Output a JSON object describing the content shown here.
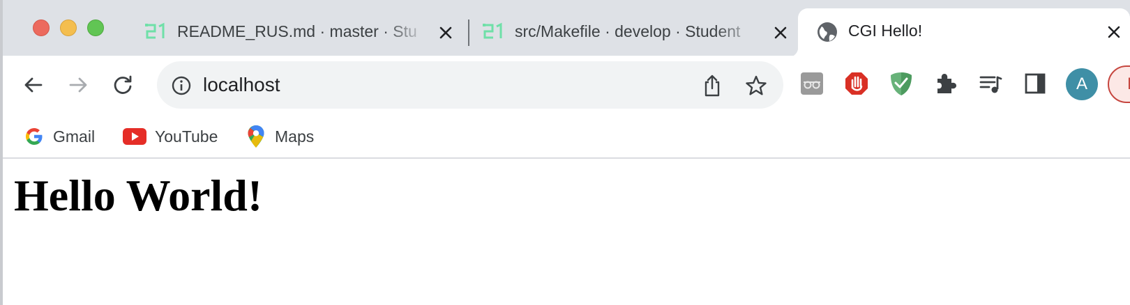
{
  "tabs": [
    {
      "title": "README_RUS.md · master · Stu",
      "favicon": "school-21-logo-icon",
      "active": false
    },
    {
      "title": "src/Makefile · develop · Student",
      "favicon": "school-21-logo-icon",
      "active": false
    },
    {
      "title": "CGI Hello!",
      "favicon": "globe-icon",
      "active": true
    }
  ],
  "toolbar": {
    "back_icon": "back-arrow-icon",
    "forward_icon": "forward-arrow-icon",
    "reload_icon": "reload-icon",
    "address": "localhost",
    "site_info_icon": "info-icon",
    "share_icon": "share-icon",
    "bookmark_icon": "star-icon",
    "extensions": [
      "incognito-ext-icon",
      "adblock-hand-icon",
      "adguard-shield-icon",
      "puzzle-extensions-icon",
      "media-queue-icon",
      "side-panel-icon"
    ],
    "avatar_initial": "A",
    "profile_initial": "P"
  },
  "bookmarks": [
    {
      "label": "Gmail",
      "icon": "google-g-icon"
    },
    {
      "label": "YouTube",
      "icon": "youtube-icon"
    },
    {
      "label": "Maps",
      "icon": "maps-pin-icon"
    }
  ],
  "page": {
    "heading": "Hello World!"
  },
  "colors": {
    "tabstrip_bg": "#dee1e6",
    "school21_green": "#6fe0a8",
    "avatar_bg": "#3f8fa6",
    "adblock_red": "#d93025",
    "adguard_green": "#67b279"
  }
}
